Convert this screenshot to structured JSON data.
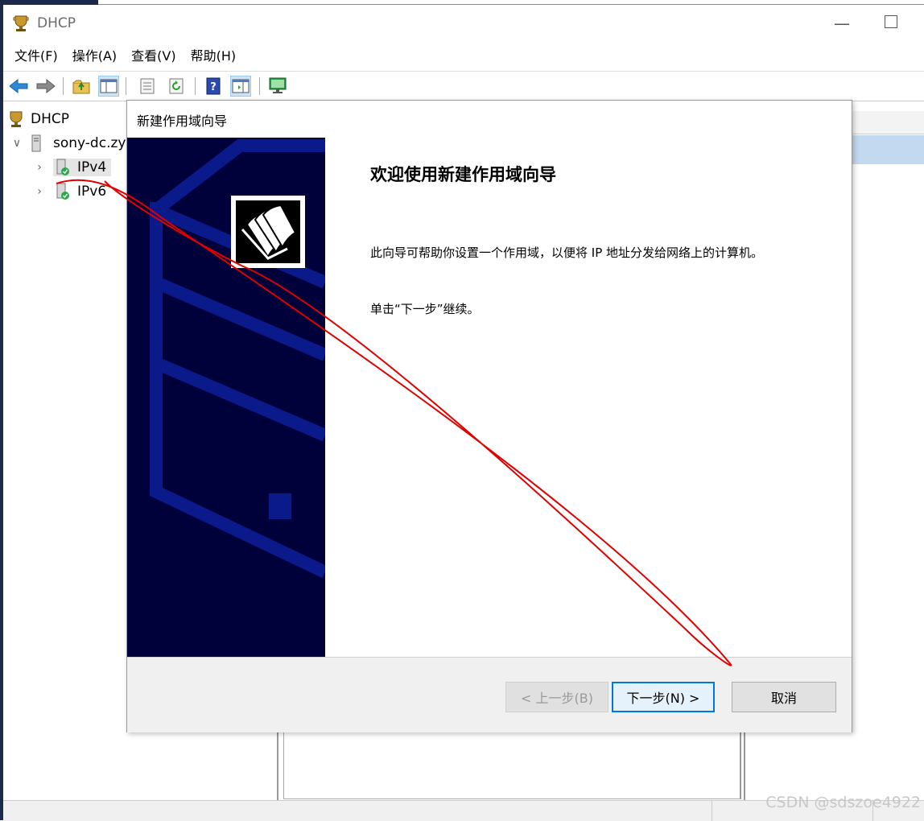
{
  "window": {
    "title": "DHCP"
  },
  "menu": [
    {
      "label": "文件(F)"
    },
    {
      "label": "操作(A)"
    },
    {
      "label": "查看(V)"
    },
    {
      "label": "帮助(H)"
    }
  ],
  "toolbar": {
    "icons": [
      "back-arrow-icon",
      "forward-arrow-icon",
      "up-folder-icon",
      "show-hide-tree-icon",
      "properties-icon",
      "refresh-icon",
      "help-icon",
      "action-pane-icon",
      "monitor-icon"
    ]
  },
  "tree": {
    "root": "DHCP",
    "server": "sony-dc.zy",
    "ipv4": "IPv4",
    "ipv6": "IPv6"
  },
  "wizard": {
    "title": "新建作用域向导",
    "heading": "欢迎使用新建作用域向导",
    "description": "此向导可帮助你设置一个作用域，以便将 IP 地址分发给网络上的计算机。",
    "instruction": "单击“下一步”继续。",
    "back_label": "< 上一步(B)",
    "next_label": "下一步(N) >",
    "cancel_label": "取消"
  },
  "watermark": "CSDN @sdszoe4922",
  "colors": {
    "banner": "#00003a",
    "banner_shape": "#0a1a8a",
    "accent": "#0078d7",
    "annotation": "#e00000"
  }
}
